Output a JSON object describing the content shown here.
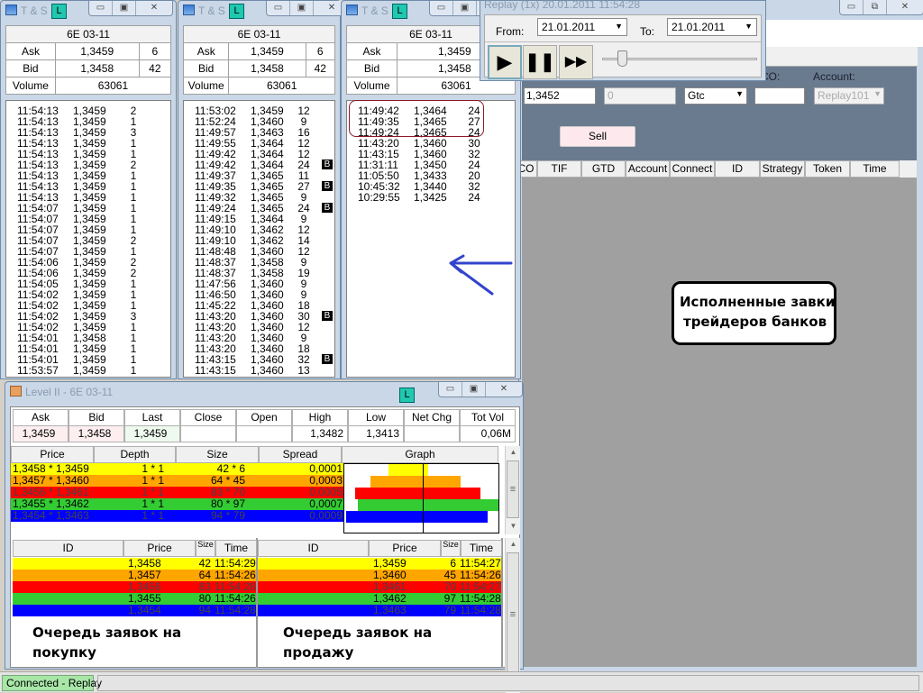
{
  "main_window": {
    "controls": [
      "▭",
      "⧉",
      "✕"
    ]
  },
  "order_panel": {
    "oco_label": "CO:",
    "account_label": "Account:",
    "price_value": "1,3452",
    "qty_value": "0",
    "tif_value": "Gtc",
    "oco_value": "",
    "account_value": "Replay101",
    "sell_button": "Sell"
  },
  "orders_table": {
    "columns": [
      "CO",
      "TIF",
      "GTD",
      "Account",
      "Connect",
      "ID",
      "Strategy",
      "Token",
      "Time"
    ]
  },
  "replay": {
    "title": "Replay (1x) 20.01.2011 11:54:28",
    "from_label": "From:",
    "from_value": "21.01.2011",
    "to_label": "To:",
    "to_value": "21.01.2011",
    "speed_slider": 0.1
  },
  "ts_windows": [
    {
      "title": "T & S",
      "badge": "L",
      "instrument": "6E 03-11",
      "ask_label": "Ask",
      "ask_price": "1,3459",
      "ask_size": "6",
      "bid_label": "Bid",
      "bid_price": "1,3458",
      "bid_size": "42",
      "volume_label": "Volume",
      "volume": "63061",
      "rows": [
        [
          "11:54:13",
          "1,3459",
          "2"
        ],
        [
          "11:54:13",
          "1,3459",
          "1"
        ],
        [
          "11:54:13",
          "1,3459",
          "3"
        ],
        [
          "11:54:13",
          "1,3459",
          "1"
        ],
        [
          "11:54:13",
          "1,3459",
          "1"
        ],
        [
          "11:54:13",
          "1,3459",
          "2"
        ],
        [
          "11:54:13",
          "1,3459",
          "1"
        ],
        [
          "11:54:13",
          "1,3459",
          "1"
        ],
        [
          "11:54:13",
          "1,3459",
          "1"
        ],
        [
          "11:54:07",
          "1,3459",
          "1"
        ],
        [
          "11:54:07",
          "1,3459",
          "1"
        ],
        [
          "11:54:07",
          "1,3459",
          "1"
        ],
        [
          "11:54:07",
          "1,3459",
          "2"
        ],
        [
          "11:54:07",
          "1,3459",
          "1"
        ],
        [
          "11:54:06",
          "1,3459",
          "2"
        ],
        [
          "11:54:06",
          "1,3459",
          "2"
        ],
        [
          "11:54:05",
          "1,3459",
          "1"
        ],
        [
          "11:54:02",
          "1,3459",
          "1"
        ],
        [
          "11:54:02",
          "1,3459",
          "1"
        ],
        [
          "11:54:02",
          "1,3459",
          "3"
        ],
        [
          "11:54:02",
          "1,3459",
          "1"
        ],
        [
          "11:54:01",
          "1,3458",
          "1"
        ],
        [
          "11:54:01",
          "1,3459",
          "1"
        ],
        [
          "11:54:01",
          "1,3459",
          "1"
        ],
        [
          "11:53:57",
          "1,3459",
          "1"
        ]
      ]
    },
    {
      "title": "T & S",
      "badge": "L",
      "instrument": "6E 03-11",
      "ask_label": "Ask",
      "ask_price": "1,3459",
      "ask_size": "6",
      "bid_label": "Bid",
      "bid_price": "1,3458",
      "bid_size": "42",
      "volume_label": "Volume",
      "volume": "63061",
      "rows": [
        [
          "11:53:02",
          "1,3459",
          "12",
          ""
        ],
        [
          "11:52:24",
          "1,3460",
          "9",
          ""
        ],
        [
          "11:49:57",
          "1,3463",
          "16",
          ""
        ],
        [
          "11:49:55",
          "1,3464",
          "12",
          ""
        ],
        [
          "11:49:42",
          "1,3464",
          "12",
          ""
        ],
        [
          "11:49:42",
          "1,3464",
          "24",
          "B"
        ],
        [
          "11:49:37",
          "1,3465",
          "11",
          ""
        ],
        [
          "11:49:35",
          "1,3465",
          "27",
          "B"
        ],
        [
          "11:49:32",
          "1,3465",
          "9",
          ""
        ],
        [
          "11:49:24",
          "1,3465",
          "24",
          "B"
        ],
        [
          "11:49:15",
          "1,3464",
          "9",
          ""
        ],
        [
          "11:49:10",
          "1,3462",
          "12",
          ""
        ],
        [
          "11:49:10",
          "1,3462",
          "14",
          ""
        ],
        [
          "11:48:48",
          "1,3460",
          "12",
          ""
        ],
        [
          "11:48:37",
          "1,3458",
          "9",
          ""
        ],
        [
          "11:48:37",
          "1,3458",
          "19",
          ""
        ],
        [
          "11:47:56",
          "1,3460",
          "9",
          ""
        ],
        [
          "11:46:50",
          "1,3460",
          "9",
          ""
        ],
        [
          "11:45:22",
          "1,3460",
          "18",
          ""
        ],
        [
          "11:43:20",
          "1,3460",
          "30",
          "B"
        ],
        [
          "11:43:20",
          "1,3460",
          "12",
          ""
        ],
        [
          "11:43:20",
          "1,3460",
          "9",
          ""
        ],
        [
          "11:43:20",
          "1,3460",
          "18",
          ""
        ],
        [
          "11:43:15",
          "1,3460",
          "32",
          "B"
        ],
        [
          "11:43:15",
          "1,3460",
          "13",
          ""
        ]
      ]
    },
    {
      "title": "T & S",
      "badge": "L",
      "instrument": "6E 03-11",
      "ask_label": "Ask",
      "ask_price": "1,3459",
      "ask_size": "",
      "bid_label": "Bid",
      "bid_price": "1,3458",
      "bid_size": "",
      "volume_label": "Volume",
      "volume": "63061",
      "rows": [
        [
          "11:49:42",
          "1,3464",
          "24"
        ],
        [
          "11:49:35",
          "1,3465",
          "27"
        ],
        [
          "11:49:24",
          "1,3465",
          "24"
        ],
        [
          "11:43:20",
          "1,3460",
          "30"
        ],
        [
          "11:43:15",
          "1,3460",
          "32"
        ],
        [
          "11:31:11",
          "1,3450",
          "24"
        ],
        [
          "11:05:50",
          "1,3433",
          "20"
        ],
        [
          "10:45:32",
          "1,3440",
          "32"
        ],
        [
          "10:29:55",
          "1,3425",
          "24"
        ]
      ]
    }
  ],
  "level2": {
    "title": "Level II - 6E 03-11",
    "badge": "L",
    "summary_headers": [
      "Ask",
      "Bid",
      "Last",
      "Close",
      "Open",
      "High",
      "Low",
      "Net Chg",
      "Tot Vol"
    ],
    "summary_values": [
      "1,3459",
      "1,3458",
      "1,3459",
      "",
      "",
      "1,3482",
      "1,3413",
      "",
      "0,06M"
    ],
    "depth_headers": [
      "Price",
      "Depth",
      "Size",
      "Spread",
      "Graph"
    ],
    "depth_rows": [
      {
        "price": "1,3458 * 1,3459",
        "depth": "1 * 1",
        "size": "42 * 6",
        "spread": "0,0001",
        "bid_size": 42,
        "ask_size": 6,
        "color": "#ffff00"
      },
      {
        "price": "1,3457 * 1,3460",
        "depth": "1 * 1",
        "size": "64 * 45",
        "spread": "0,0003",
        "bid_size": 64,
        "ask_size": 45,
        "color": "#ffa500"
      },
      {
        "price": "1,3456 * 1,3461",
        "depth": "1 * 1",
        "size": "83 * 70",
        "spread": "0,0005",
        "bid_size": 83,
        "ask_size": 70,
        "color": "#ff0000"
      },
      {
        "price": "1,3455 * 1,3462",
        "depth": "1 * 1",
        "size": "80 * 97",
        "spread": "0,0007",
        "bid_size": 80,
        "ask_size": 97,
        "color": "#33cc33"
      },
      {
        "price": "1,3454 * 1,3463",
        "depth": "1 * 1",
        "size": "94 * 79",
        "spread": "0,0009",
        "bid_size": 94,
        "ask_size": 79,
        "color": "#0000ff"
      }
    ],
    "queue_headers": [
      "ID",
      "Price",
      "Size",
      "Time"
    ],
    "bid_queue": [
      [
        "",
        "1,3458",
        "42",
        "11:54:29"
      ],
      [
        "",
        "1,3457",
        "64",
        "11:54:26"
      ],
      [
        "",
        "1,3456",
        "83",
        "11:54:28"
      ],
      [
        "",
        "1,3455",
        "80",
        "11:54:26"
      ],
      [
        "",
        "1,3454",
        "94",
        "11:54:28"
      ]
    ],
    "ask_queue": [
      [
        "",
        "1,3459",
        "6",
        "11:54:27"
      ],
      [
        "",
        "1,3460",
        "45",
        "11:54:26"
      ],
      [
        "",
        "1,3461",
        "70",
        "11:54:27"
      ],
      [
        "",
        "1,3462",
        "97",
        "11:54:28"
      ],
      [
        "",
        "1,3463",
        "79",
        "11:54:28"
      ]
    ],
    "row_colors": [
      "#ffff00",
      "#ffa500",
      "#ff0000",
      "#33cc33",
      "#0000ff"
    ]
  },
  "annotations": {
    "bank_trades_line1": "Исполненные завки",
    "bank_trades_line2": "трейдеров банков",
    "buy_queue_line1": "Очередь заявок на",
    "buy_queue_line2": "покупку",
    "sell_queue_line1": "Очередь заявок на",
    "sell_queue_line2": "продажу",
    "arrow_color": "#3344cc",
    "highlight_color": "#8b1a2a"
  },
  "status_bar": {
    "connection": "Connected - Replay"
  }
}
